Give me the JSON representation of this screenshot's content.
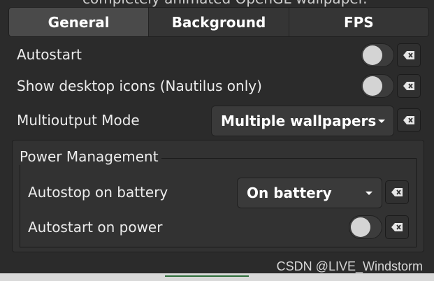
{
  "header": {
    "partial_title": "completely animated OpenGL wallpaper."
  },
  "tabs": [
    {
      "label": "General",
      "active": true
    },
    {
      "label": "Background",
      "active": false
    },
    {
      "label": "FPS",
      "active": false
    }
  ],
  "general": {
    "autostart": {
      "label": "Autostart",
      "enabled": false
    },
    "show_desktop_icons": {
      "label": "Show desktop icons (Nautilus only)",
      "enabled": false
    },
    "multioutput_mode": {
      "label": "Multioutput Mode",
      "value": "Multiple wallpapers"
    }
  },
  "power_management": {
    "title": "Power Management",
    "autostop_on_battery": {
      "label": "Autostop on battery",
      "value": "On battery"
    },
    "autostart_on_power": {
      "label": "Autostart on power",
      "enabled": false
    }
  },
  "icons": {
    "reset": "clear-backspace-icon",
    "dropdown": "chevron-down-icon"
  },
  "colors": {
    "background": "#2b2b2b",
    "tab_active": "#4a4a4a",
    "switch_off_track": "#3c3c3c",
    "switch_knob": "#d4d4d4",
    "text": "#ececec"
  },
  "watermark": "CSDN @LIVE_Windstorm"
}
